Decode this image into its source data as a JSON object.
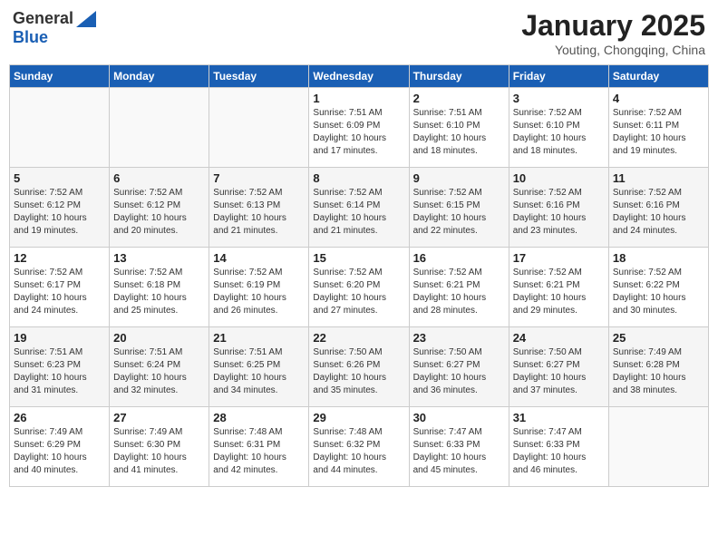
{
  "logo": {
    "general": "General",
    "blue": "Blue"
  },
  "title": "January 2025",
  "subtitle": "Youting, Chongqing, China",
  "weekdays": [
    "Sunday",
    "Monday",
    "Tuesday",
    "Wednesday",
    "Thursday",
    "Friday",
    "Saturday"
  ],
  "weeks": [
    [
      {
        "day": "",
        "info": ""
      },
      {
        "day": "",
        "info": ""
      },
      {
        "day": "",
        "info": ""
      },
      {
        "day": "1",
        "info": "Sunrise: 7:51 AM\nSunset: 6:09 PM\nDaylight: 10 hours\nand 17 minutes."
      },
      {
        "day": "2",
        "info": "Sunrise: 7:51 AM\nSunset: 6:10 PM\nDaylight: 10 hours\nand 18 minutes."
      },
      {
        "day": "3",
        "info": "Sunrise: 7:52 AM\nSunset: 6:10 PM\nDaylight: 10 hours\nand 18 minutes."
      },
      {
        "day": "4",
        "info": "Sunrise: 7:52 AM\nSunset: 6:11 PM\nDaylight: 10 hours\nand 19 minutes."
      }
    ],
    [
      {
        "day": "5",
        "info": "Sunrise: 7:52 AM\nSunset: 6:12 PM\nDaylight: 10 hours\nand 19 minutes."
      },
      {
        "day": "6",
        "info": "Sunrise: 7:52 AM\nSunset: 6:12 PM\nDaylight: 10 hours\nand 20 minutes."
      },
      {
        "day": "7",
        "info": "Sunrise: 7:52 AM\nSunset: 6:13 PM\nDaylight: 10 hours\nand 21 minutes."
      },
      {
        "day": "8",
        "info": "Sunrise: 7:52 AM\nSunset: 6:14 PM\nDaylight: 10 hours\nand 21 minutes."
      },
      {
        "day": "9",
        "info": "Sunrise: 7:52 AM\nSunset: 6:15 PM\nDaylight: 10 hours\nand 22 minutes."
      },
      {
        "day": "10",
        "info": "Sunrise: 7:52 AM\nSunset: 6:16 PM\nDaylight: 10 hours\nand 23 minutes."
      },
      {
        "day": "11",
        "info": "Sunrise: 7:52 AM\nSunset: 6:16 PM\nDaylight: 10 hours\nand 24 minutes."
      }
    ],
    [
      {
        "day": "12",
        "info": "Sunrise: 7:52 AM\nSunset: 6:17 PM\nDaylight: 10 hours\nand 24 minutes."
      },
      {
        "day": "13",
        "info": "Sunrise: 7:52 AM\nSunset: 6:18 PM\nDaylight: 10 hours\nand 25 minutes."
      },
      {
        "day": "14",
        "info": "Sunrise: 7:52 AM\nSunset: 6:19 PM\nDaylight: 10 hours\nand 26 minutes."
      },
      {
        "day": "15",
        "info": "Sunrise: 7:52 AM\nSunset: 6:20 PM\nDaylight: 10 hours\nand 27 minutes."
      },
      {
        "day": "16",
        "info": "Sunrise: 7:52 AM\nSunset: 6:21 PM\nDaylight: 10 hours\nand 28 minutes."
      },
      {
        "day": "17",
        "info": "Sunrise: 7:52 AM\nSunset: 6:21 PM\nDaylight: 10 hours\nand 29 minutes."
      },
      {
        "day": "18",
        "info": "Sunrise: 7:52 AM\nSunset: 6:22 PM\nDaylight: 10 hours\nand 30 minutes."
      }
    ],
    [
      {
        "day": "19",
        "info": "Sunrise: 7:51 AM\nSunset: 6:23 PM\nDaylight: 10 hours\nand 31 minutes."
      },
      {
        "day": "20",
        "info": "Sunrise: 7:51 AM\nSunset: 6:24 PM\nDaylight: 10 hours\nand 32 minutes."
      },
      {
        "day": "21",
        "info": "Sunrise: 7:51 AM\nSunset: 6:25 PM\nDaylight: 10 hours\nand 34 minutes."
      },
      {
        "day": "22",
        "info": "Sunrise: 7:50 AM\nSunset: 6:26 PM\nDaylight: 10 hours\nand 35 minutes."
      },
      {
        "day": "23",
        "info": "Sunrise: 7:50 AM\nSunset: 6:27 PM\nDaylight: 10 hours\nand 36 minutes."
      },
      {
        "day": "24",
        "info": "Sunrise: 7:50 AM\nSunset: 6:27 PM\nDaylight: 10 hours\nand 37 minutes."
      },
      {
        "day": "25",
        "info": "Sunrise: 7:49 AM\nSunset: 6:28 PM\nDaylight: 10 hours\nand 38 minutes."
      }
    ],
    [
      {
        "day": "26",
        "info": "Sunrise: 7:49 AM\nSunset: 6:29 PM\nDaylight: 10 hours\nand 40 minutes."
      },
      {
        "day": "27",
        "info": "Sunrise: 7:49 AM\nSunset: 6:30 PM\nDaylight: 10 hours\nand 41 minutes."
      },
      {
        "day": "28",
        "info": "Sunrise: 7:48 AM\nSunset: 6:31 PM\nDaylight: 10 hours\nand 42 minutes."
      },
      {
        "day": "29",
        "info": "Sunrise: 7:48 AM\nSunset: 6:32 PM\nDaylight: 10 hours\nand 44 minutes."
      },
      {
        "day": "30",
        "info": "Sunrise: 7:47 AM\nSunset: 6:33 PM\nDaylight: 10 hours\nand 45 minutes."
      },
      {
        "day": "31",
        "info": "Sunrise: 7:47 AM\nSunset: 6:33 PM\nDaylight: 10 hours\nand 46 minutes."
      },
      {
        "day": "",
        "info": ""
      }
    ]
  ]
}
